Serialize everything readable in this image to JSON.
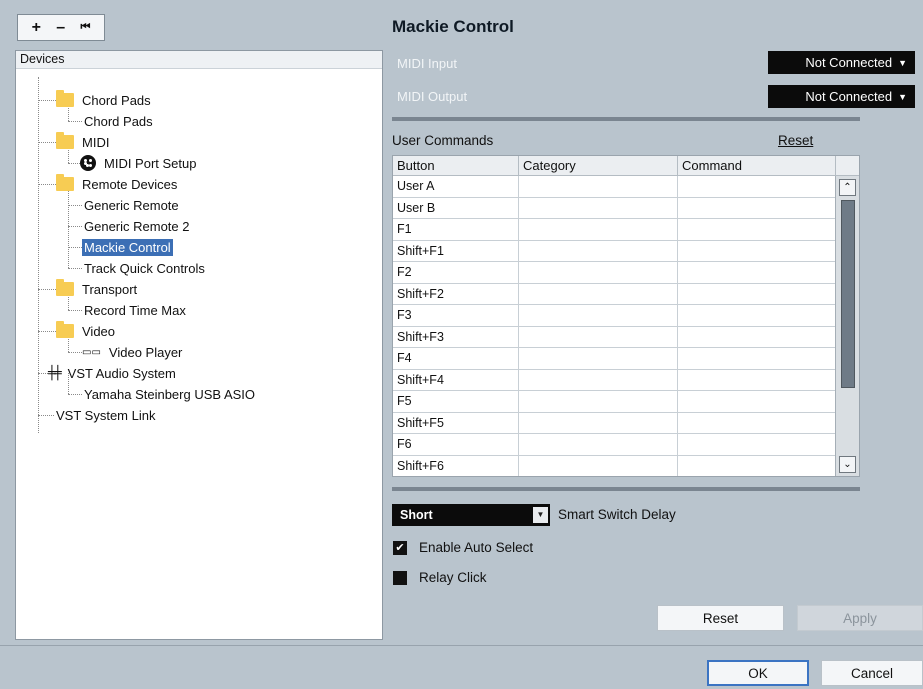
{
  "toolbar": {
    "add": "+",
    "remove": "–",
    "reset_icon": "⏮"
  },
  "tree": {
    "header": "Devices",
    "items": [
      {
        "label": "Chord Pads",
        "icon": "folder-icon"
      },
      {
        "label": "Chord Pads"
      },
      {
        "label": "MIDI",
        "icon": "folder-icon"
      },
      {
        "label": "MIDI Port Setup",
        "icon": "midi-port-icon"
      },
      {
        "label": "Remote Devices",
        "icon": "folder-icon"
      },
      {
        "label": "Generic Remote"
      },
      {
        "label": "Generic Remote 2"
      },
      {
        "label": "Mackie Control",
        "selected": true
      },
      {
        "label": "Track Quick Controls"
      },
      {
        "label": "Transport",
        "icon": "folder-icon"
      },
      {
        "label": "Record Time Max"
      },
      {
        "label": "Video",
        "icon": "folder-icon"
      },
      {
        "label": "Video Player",
        "icon": "video-icon"
      },
      {
        "label": "VST Audio System",
        "icon": "vst-audio-icon"
      },
      {
        "label": "Yamaha Steinberg USB ASIO"
      },
      {
        "label": "VST System Link"
      }
    ]
  },
  "panel": {
    "title": "Mackie Control",
    "midi_input_label": "MIDI Input",
    "midi_input_value": "Not Connected",
    "midi_output_label": "MIDI Output",
    "midi_output_value": "Not Connected",
    "dropdown_arrow": "▼",
    "user_commands_label": "User Commands",
    "user_commands_reset": "Reset"
  },
  "table": {
    "headers": [
      "Button",
      "Category",
      "Command"
    ],
    "rows": [
      [
        "User A",
        "",
        ""
      ],
      [
        "User B",
        "",
        ""
      ],
      [
        "F1",
        "",
        ""
      ],
      [
        "Shift+F1",
        "",
        ""
      ],
      [
        "F2",
        "",
        ""
      ],
      [
        "Shift+F2",
        "",
        ""
      ],
      [
        "F3",
        "",
        ""
      ],
      [
        "Shift+F3",
        "",
        ""
      ],
      [
        "F4",
        "",
        ""
      ],
      [
        "Shift+F4",
        "",
        ""
      ],
      [
        "F5",
        "",
        ""
      ],
      [
        "Shift+F5",
        "",
        ""
      ],
      [
        "F6",
        "",
        ""
      ],
      [
        "Shift+F6",
        "",
        ""
      ]
    ],
    "scroll_up": "⌃",
    "scroll_down": "⌄"
  },
  "options": {
    "smart_switch_value": "Short",
    "smart_switch_label": "Smart Switch Delay",
    "enable_auto_select_label": "Enable Auto Select",
    "enable_auto_select_checked": true,
    "relay_click_label": "Relay Click",
    "relay_click_checked": false
  },
  "buttons": {
    "reset": "Reset",
    "apply": "Apply",
    "ok": "OK",
    "cancel": "Cancel"
  },
  "colors": {
    "background": "#b9c4cd",
    "selection": "#3c6fb5",
    "dropdown": "#0b0b0b",
    "folder": "#f7cc53",
    "ok_border": "#3b74c3"
  }
}
